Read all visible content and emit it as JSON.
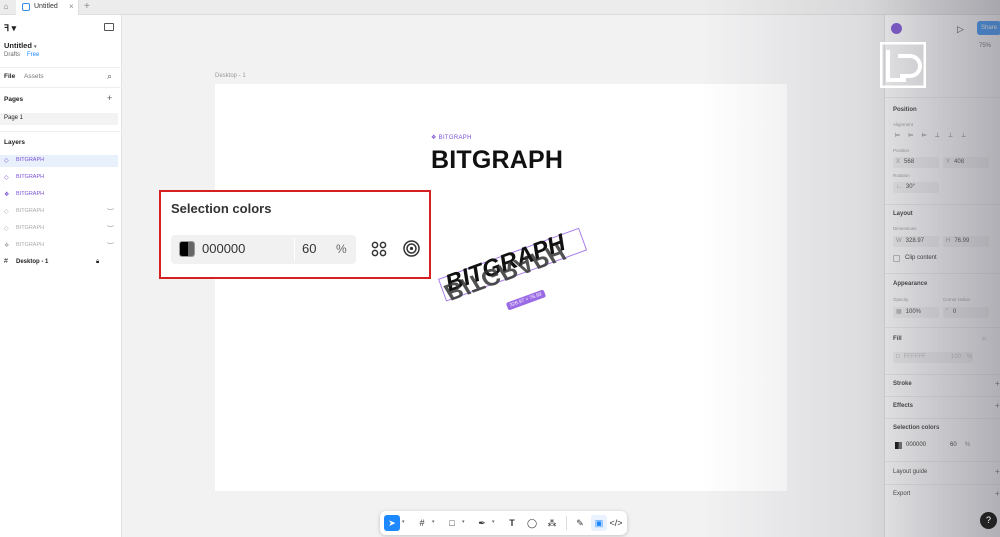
{
  "tabbar": {
    "tab_title": "Untitled",
    "close": "×",
    "add": "+",
    "home": "⌂"
  },
  "file": {
    "name": "Untitled",
    "location": "Drafts",
    "plan": "Free"
  },
  "left_tabs": {
    "file": "File",
    "assets": "Assets"
  },
  "pages": {
    "title": "Pages",
    "items": [
      "Page 1"
    ]
  },
  "layers": {
    "title": "Layers",
    "items": [
      {
        "label": "BITGRAPH"
      },
      {
        "label": "BITGRAPH"
      },
      {
        "label": "BITGRAPH"
      },
      {
        "label": "BITGRAPH"
      },
      {
        "label": "BITGRAPH"
      },
      {
        "label": "BITGRAPH"
      },
      {
        "label": "Desktop - 1"
      }
    ]
  },
  "canvas": {
    "frame_label": "Desktop - 1",
    "small_tag": "BITGRAPH",
    "big_title": "BITGRAPH",
    "rotated_text": "BITGRAPH",
    "mirrored_text": "BITGRAPH",
    "dimension_badge": "328.97 × 76.99"
  },
  "zoom": {
    "title": "Selection colors",
    "hex": "000000",
    "opacity": "60",
    "percent": "%"
  },
  "right": {
    "zoom_level": "75%",
    "share": "Share",
    "position": {
      "title": "Position",
      "alignment_label": "Alignment",
      "position_label": "Position",
      "x": "568",
      "y": "408",
      "rotation_label": "Rotation",
      "rotation": "30°"
    },
    "layout": {
      "title": "Layout",
      "dimensions_label": "Dimensions",
      "w": "328.97",
      "h": "76.99",
      "clip": "Clip content"
    },
    "appearance": {
      "title": "Appearance",
      "opacity_label": "Opacity",
      "opacity": "100%",
      "radius_label": "Corner radius",
      "radius": "0"
    },
    "fill": {
      "title": "Fill",
      "hex": "FFFFFF",
      "opacity": "100",
      "pct": "%"
    },
    "stroke": "Stroke",
    "effects": "Effects",
    "selection_colors": {
      "title": "Selection colors",
      "hex": "000000",
      "opacity": "60",
      "pct": "%"
    },
    "layout_guide": "Layout guide",
    "export": "Export"
  },
  "help": "?",
  "colors": {
    "accent": "#1e88ff",
    "purple": "#7a4fd6",
    "highlight": "#d42020"
  }
}
